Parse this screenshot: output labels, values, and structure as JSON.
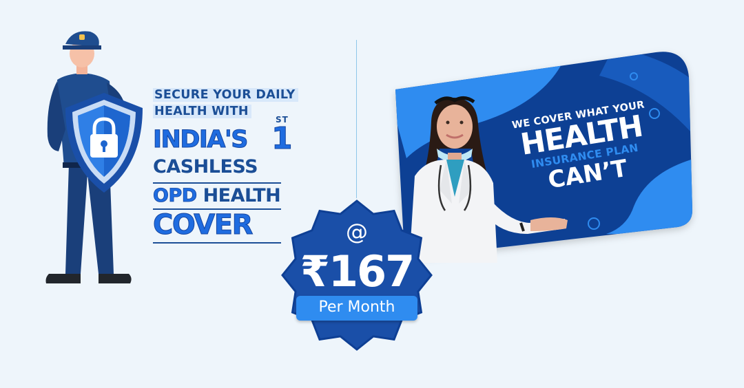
{
  "headline": {
    "line1": "SECURE YOUR DAILY",
    "line2": "HEALTH WITH",
    "line3": "INDIA'S",
    "first_number": "1",
    "first_suffix": "ST",
    "line4": "CASHLESS",
    "line5_opd": "OPD",
    "line5_rest": "HEALTH",
    "line6": "COVER"
  },
  "price_badge": {
    "at": "@",
    "amount": "₹167",
    "period": "Per Month"
  },
  "card": {
    "line1": "WE COVER WHAT YOUR",
    "line2": "HEALTH",
    "line3": "INSURANCE PLAN",
    "line4": "CAN’T"
  },
  "colors": {
    "background": "#eef5fb",
    "brand_dark": "#1b4e96",
    "brand_blue": "#1f6ce0",
    "card_navy": "#0e3f94",
    "card_light": "#2f8cf0"
  },
  "icons": [
    "security-guard-illustration",
    "shield-lock-icon",
    "doctor-photo",
    "price-starburst"
  ]
}
